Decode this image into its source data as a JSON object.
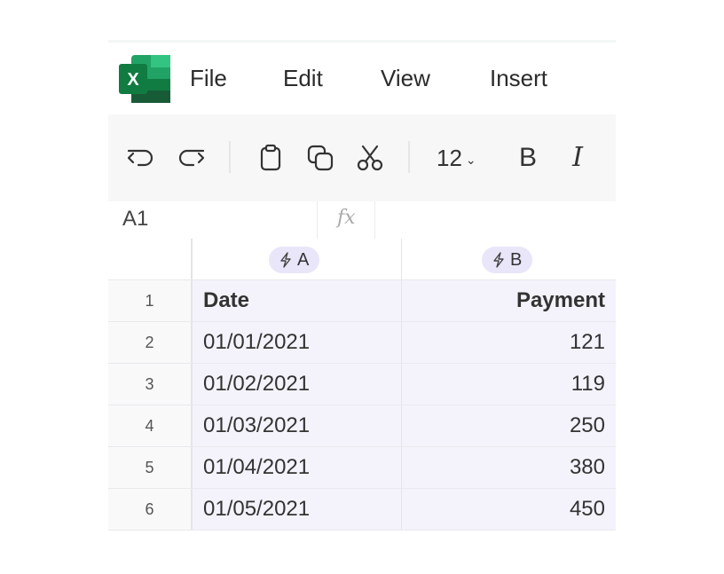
{
  "app": {
    "name": "Excel",
    "logo_letter": "X",
    "brand_color": "#1d7044"
  },
  "menu": {
    "file": "File",
    "edit": "Edit",
    "view": "View",
    "insert": "Insert"
  },
  "toolbar": {
    "icons": [
      "undo-icon",
      "redo-icon",
      "paste-icon",
      "copy-icon",
      "cut-icon",
      "bold-icon",
      "italic-icon"
    ],
    "font_size": "12",
    "bold_label": "B",
    "italic_label": "I"
  },
  "formula_bar": {
    "cell_ref": "A1",
    "fx_label": "fx",
    "value": ""
  },
  "columns": [
    {
      "letter": "A"
    },
    {
      "letter": "B"
    }
  ],
  "rows": [
    {
      "num": "1",
      "a": "Date",
      "b": "Payment"
    },
    {
      "num": "2",
      "a": "01/01/2021",
      "b": "121"
    },
    {
      "num": "3",
      "a": "01/02/2021",
      "b": "119"
    },
    {
      "num": "4",
      "a": "01/03/2021",
      "b": "250"
    },
    {
      "num": "5",
      "a": "01/04/2021",
      "b": "380"
    },
    {
      "num": "6",
      "a": "01/05/2021",
      "b": "450"
    }
  ]
}
